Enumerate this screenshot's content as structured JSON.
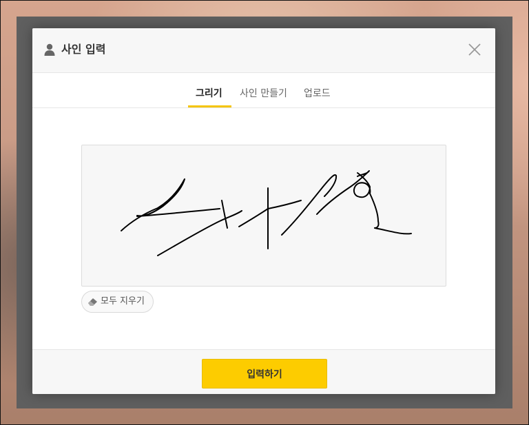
{
  "dialog": {
    "title": "사인 입력",
    "title_icon": "user-icon",
    "close_icon": "close-icon"
  },
  "tabs": [
    {
      "label": "그리기",
      "active": true
    },
    {
      "label": "사인 만들기",
      "active": false
    },
    {
      "label": "업로드",
      "active": false
    }
  ],
  "canvas": {
    "clear_label": "모두 지우기",
    "clear_icon": "eraser-icon"
  },
  "footer": {
    "submit_label": "입력하기"
  },
  "colors": {
    "accent": "#fdcc00",
    "tab_underline": "#f5c400",
    "overlay": "#5f5f5f"
  }
}
